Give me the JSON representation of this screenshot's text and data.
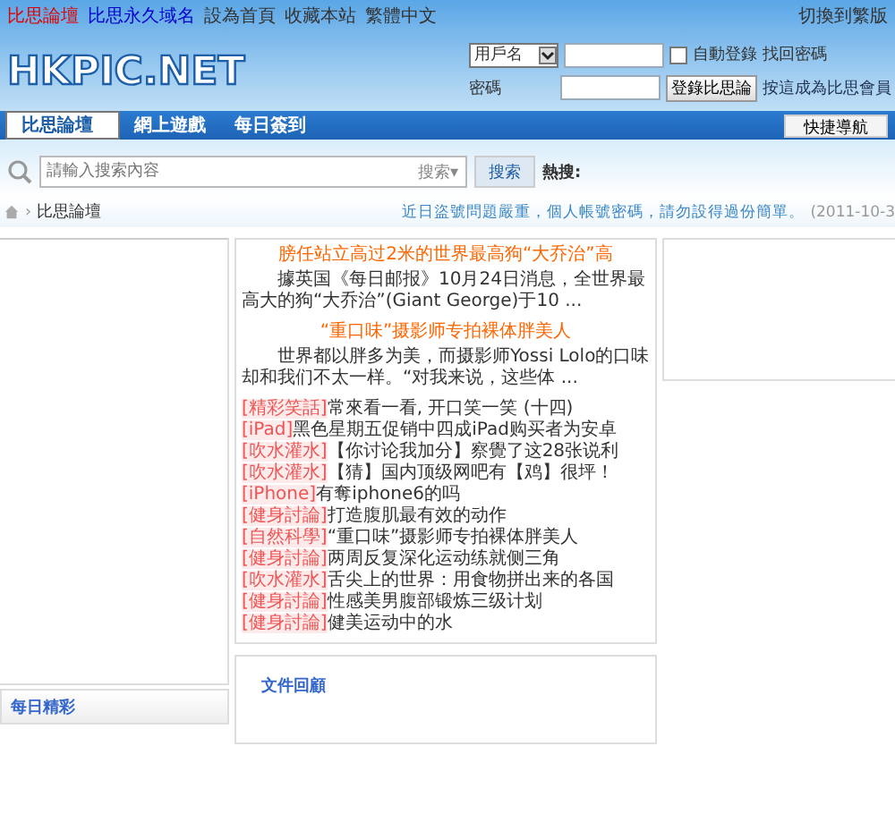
{
  "top_links": [
    {
      "label": "比思論壇",
      "kind": "red"
    },
    {
      "label": "比思永久域名",
      "kind": "blue"
    },
    {
      "label": "設為首頁",
      "kind": "plain"
    },
    {
      "label": "收藏本站",
      "kind": "plain"
    },
    {
      "label": "繁體中文",
      "kind": "plain"
    }
  ],
  "top_right": "切換到繁版",
  "logo": "HKPIC.NET",
  "login": {
    "username_select": "用戶名",
    "auto_login": {
      "label": "自動登錄",
      "checked": false
    },
    "find_password": "找回密碼",
    "password_label": "密碼",
    "login_button": "登錄比思論",
    "register": "按這成為比思會員"
  },
  "tabs": [
    {
      "label": "比思論壇",
      "selected": true
    },
    {
      "label": "網上遊戲",
      "selected": false
    },
    {
      "label": "每日簽到",
      "selected": false
    }
  ],
  "quick_nav": "快捷導航",
  "search": {
    "placeholder": "請輸入搜索內容",
    "scope": "搜索",
    "scope_caret": "▾",
    "button": "搜索",
    "hot_label": "熱搜:"
  },
  "breadcrumb": {
    "separator": "›",
    "current": "比思論壇"
  },
  "notice": {
    "text": "近日盜號問題嚴重，個人帳號密碼，請勿設得過份簡單。",
    "date": "(2011-10-3"
  },
  "features": [
    {
      "title": "膀任站立高过2米的世界最高狗“大乔治”高",
      "summary": "據英国《每日邮报》10月24日消息，全世界最高大的狗“大乔治”(Giant George)于10 ..."
    },
    {
      "title": "“重口味”摄影师专拍裸体胖美人",
      "summary": "世界都以胖多为美，而摄影师Yossi Lolo的口味却和我们不太一样。“对我来说，这些体 ..."
    }
  ],
  "threads": [
    {
      "category": "[精彩笑話]",
      "title": "常來看一看, 开口笑一笑 (十四)"
    },
    {
      "category": "[iPad]",
      "title": "黑色星期五促销中四成iPad购买者为安卓"
    },
    {
      "category": "[吹水灌水]",
      "title": "【你讨论我加分】察覺了这28张说利"
    },
    {
      "category": "[吹水灌水]",
      "title": "【猜】国内顶级网吧有【鸡】很坪！"
    },
    {
      "category": "[iPhone]",
      "title": "有奪iphone6的吗"
    },
    {
      "category": "[健身討論]",
      "title": "打造腹肌最有效的动作"
    },
    {
      "category": "[自然科學]",
      "title": "“重口味”摄影师专拍裸体胖美人"
    },
    {
      "category": "[健身討論]",
      "title": "两周反复深化运动练就侧三角"
    },
    {
      "category": "[吹水灌水]",
      "title": "舌尖上的世界：用食物拼出来的各国"
    },
    {
      "category": "[健身討論]",
      "title": "性感美男腹部锻炼三级计划"
    },
    {
      "category": "[健身討論]",
      "title": "健美运动中的水"
    }
  ],
  "files_heading": "文件回顧",
  "daily_heading": "每日精彩"
}
